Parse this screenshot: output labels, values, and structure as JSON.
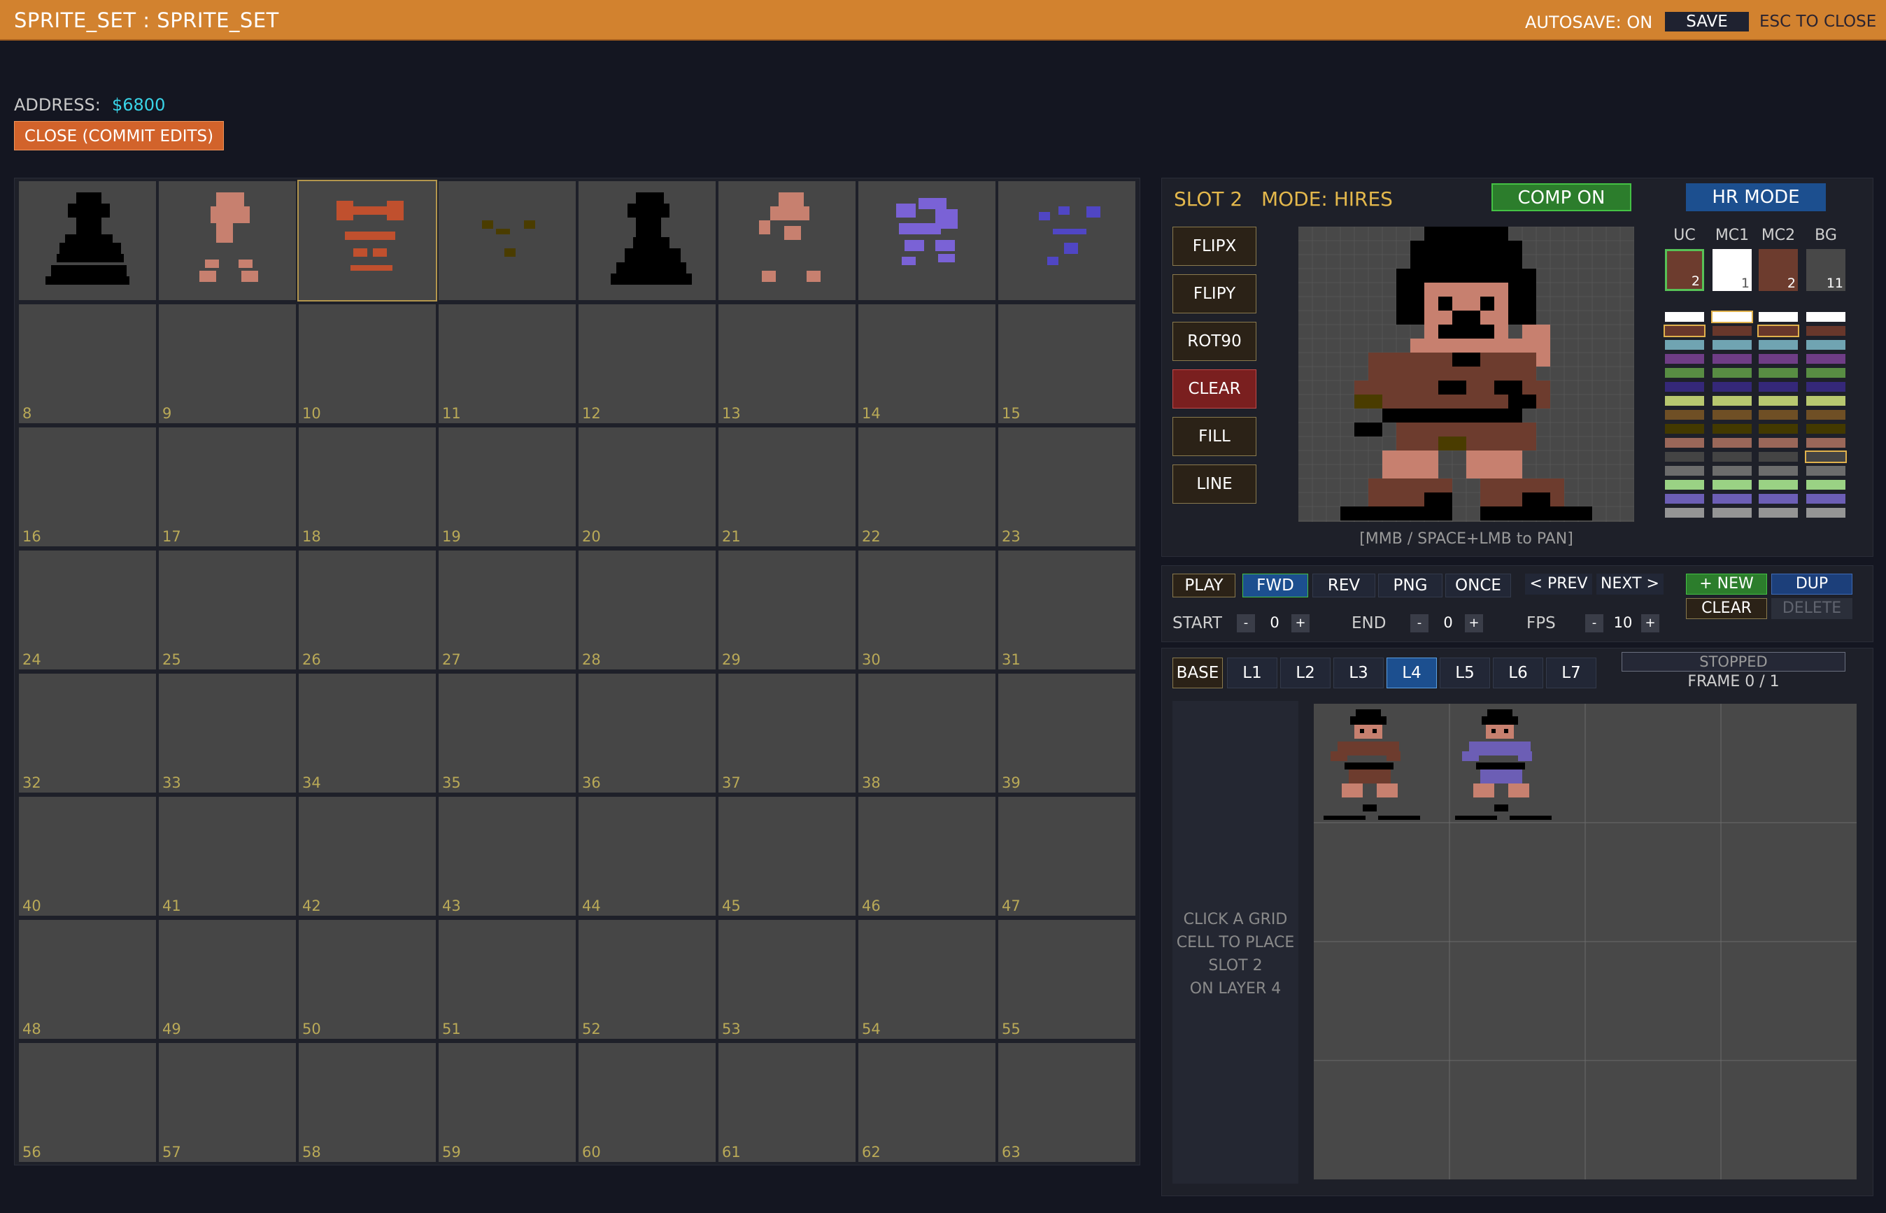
{
  "topbar": {
    "title": "SPRITE_SET : SPRITE_SET",
    "autosave": "AUTOSAVE: ON",
    "save": "SAVE",
    "esc": "ESC TO CLOSE"
  },
  "address": {
    "label": "ADDRESS:",
    "value": "$6800"
  },
  "close_button": "CLOSE (COMMIT EDITS)",
  "sprite_grid": {
    "selected_slot": 2,
    "cell_numbers": [
      "8",
      "9",
      "10",
      "11",
      "12",
      "13",
      "14",
      "15",
      "16",
      "17",
      "18",
      "19",
      "20",
      "21",
      "22",
      "23",
      "24",
      "25",
      "26",
      "27",
      "28",
      "29",
      "30",
      "31",
      "32",
      "33",
      "34",
      "35",
      "36",
      "37",
      "38",
      "39",
      "40",
      "41",
      "42",
      "43",
      "44",
      "45",
      "46",
      "47",
      "48",
      "49",
      "50",
      "51",
      "52",
      "53",
      "54",
      "55",
      "56",
      "57",
      "58",
      "59",
      "60",
      "61",
      "62",
      "63"
    ]
  },
  "editor": {
    "slot": "SLOT 2",
    "mode": "MODE: HIRES",
    "comp_button": "COMP ON",
    "hr_button": "HR MODE",
    "tools": [
      "FLIPX",
      "FLIPY",
      "ROT90",
      "CLEAR",
      "FILL",
      "LINE"
    ],
    "pan_hint": "[MMB / SPACE+LMB to PAN]",
    "color_columns": [
      "UC",
      "MC1",
      "MC2",
      "BG"
    ],
    "color_values": [
      "2",
      "1",
      "2",
      "11"
    ],
    "colors": {
      "uc": "#6d3c2e",
      "mc1": "#ffffff",
      "mc2": "#6d3c2e",
      "bg": "#484848"
    },
    "palette": [
      "#ffffff",
      "#68372b",
      "#70a4b2",
      "#6f3d86",
      "#588d43",
      "#352879",
      "#b8c76f",
      "#6f4f25",
      "#433900",
      "#9a6759",
      "#444444",
      "#6c6c6c",
      "#9ad284",
      "#6c5eb5",
      "#959595"
    ]
  },
  "anim": {
    "play": "PLAY",
    "fwd": "FWD",
    "rev": "REV",
    "png": "PNG",
    "once": "ONCE",
    "prev": "< PREV",
    "next": "NEXT >",
    "new": "+ NEW",
    "dup": "DUP",
    "clear": "CLEAR",
    "delete": "DELETE",
    "start_label": "START",
    "start_value": "0",
    "end_label": "END",
    "end_value": "0",
    "fps_label": "FPS",
    "fps_value": "10",
    "minus": "-",
    "plus": "+"
  },
  "layers": {
    "buttons": [
      "BASE",
      "L1",
      "L2",
      "L3",
      "L4",
      "L5",
      "L6",
      "L7"
    ],
    "active": "L4",
    "status": "STOPPED",
    "frame": "FRAME 0 / 1",
    "hint": [
      "CLICK A GRID",
      "CELL TO PLACE",
      "SLOT 2",
      "ON LAYER 4"
    ]
  }
}
